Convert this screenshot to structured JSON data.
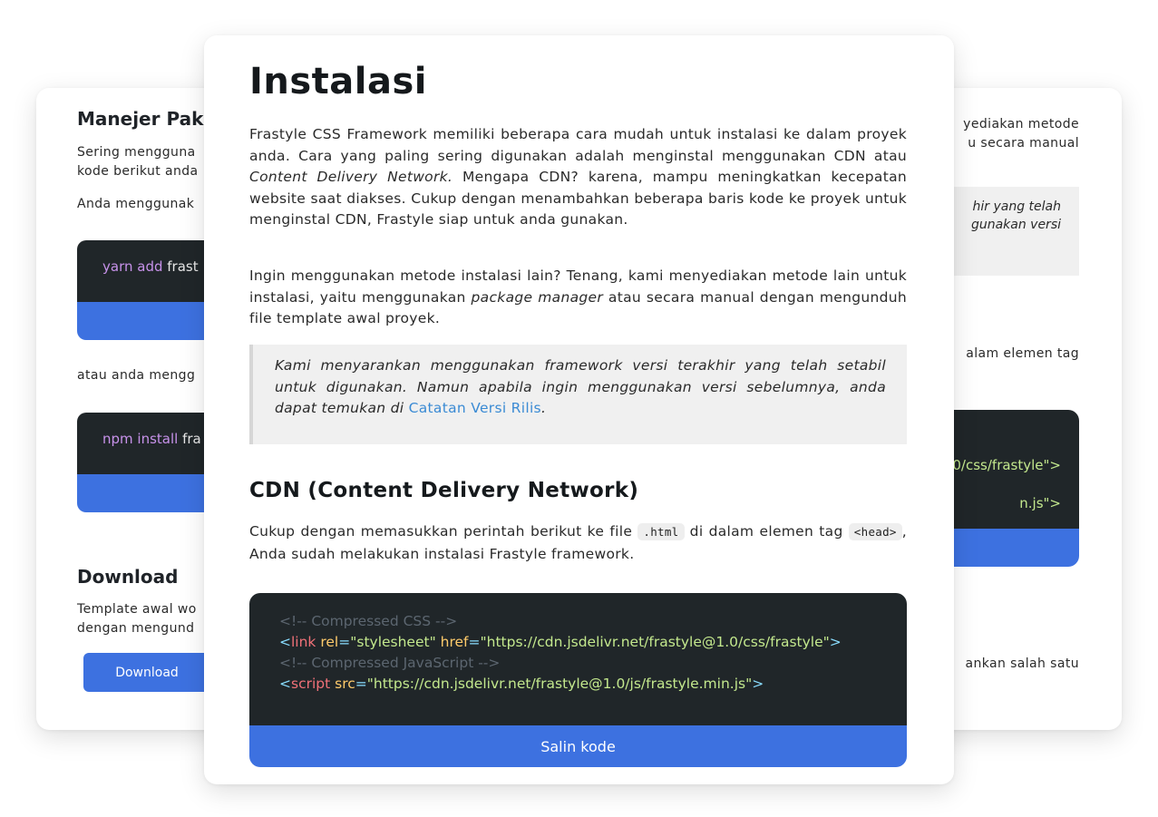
{
  "left_card": {
    "heading": "Manejer Pak",
    "para1_line1": "Sering mengguna",
    "para1_line2": "kode berikut anda",
    "para2": "Anda menggunak",
    "code1_cmd": "yarn add",
    "code1_arg": "frast",
    "para3": "atau anda mengg",
    "code2_cmd": "npm install",
    "code2_arg": "fra",
    "download_heading": "Download",
    "dl_para_line1": "Template awal wo",
    "dl_para_line2": "dengan mengund",
    "download_button": "Download"
  },
  "right_card": {
    "line1": "yediakan metode",
    "line2": "u secara manual",
    "quote_line1": "hir yang telah",
    "quote_line2": "gunakan versi",
    "line3": "alam elemen tag",
    "code_line1": "0/css/frastyle\">",
    "code_line2": "n.js\">",
    "line4": "ankan salah satu"
  },
  "front_card": {
    "title": "Instalasi",
    "para1_a": "Frastyle CSS Framework memiliki beberapa cara mudah untuk instalasi ke dalam proyek anda. Cara yang paling sering digunakan adalah menginstal menggunakan CDN atau ",
    "para1_em": "Content Delivery Network.",
    "para1_b": " Mengapa CDN? karena, mampu meningkatkan kecepatan website saat diakses. Cukup dengan menambahkan beberapa baris kode ke proyek untuk menginstal CDN, Frastyle siap untuk anda gunakan.",
    "para2_a": "Ingin menggunakan metode instalasi lain? Tenang, kami menyediakan metode lain untuk instalasi, yaitu menggunakan ",
    "para2_em": "package manager",
    "para2_b": " atau secara manual dengan mengunduh file template awal proyek.",
    "quote_text": "Kami menyarankan menggunakan framework versi terakhir yang telah setabil untuk digunakan. Namun apabila ingin menggunakan versi sebelumnya, anda dapat temukan di ",
    "quote_link": "Catatan Versi Rilis",
    "quote_end": ".",
    "cdn_heading": "CDN (Content Delivery Network)",
    "cdn_para_a": "Cukup dengan memasukkan perintah berikut ke file ",
    "cdn_code1": ".html",
    "cdn_para_b": " di dalam elemen tag ",
    "cdn_code2": "<head>",
    "cdn_para_c": ", Anda sudah melakukan instalasi Frastyle framework.",
    "code": {
      "comment1": "<!-- Compressed CSS -->",
      "line2_tag": "link",
      "line2_attr1": "rel",
      "line2_val1": "\"stylesheet\"",
      "line2_attr2": "href",
      "line2_val2": "\"https://cdn.jsdelivr.net/frastyle@1.0/css/frastyle\"",
      "comment2": "<!-- Compressed JavaScript -->",
      "line4_tag": "script",
      "line4_attr": "src",
      "line4_val": "\"https://cdn.jsdelivr.net/frastyle@1.0/js/frastyle.min.js\""
    },
    "copy_button": "Salin kode"
  }
}
